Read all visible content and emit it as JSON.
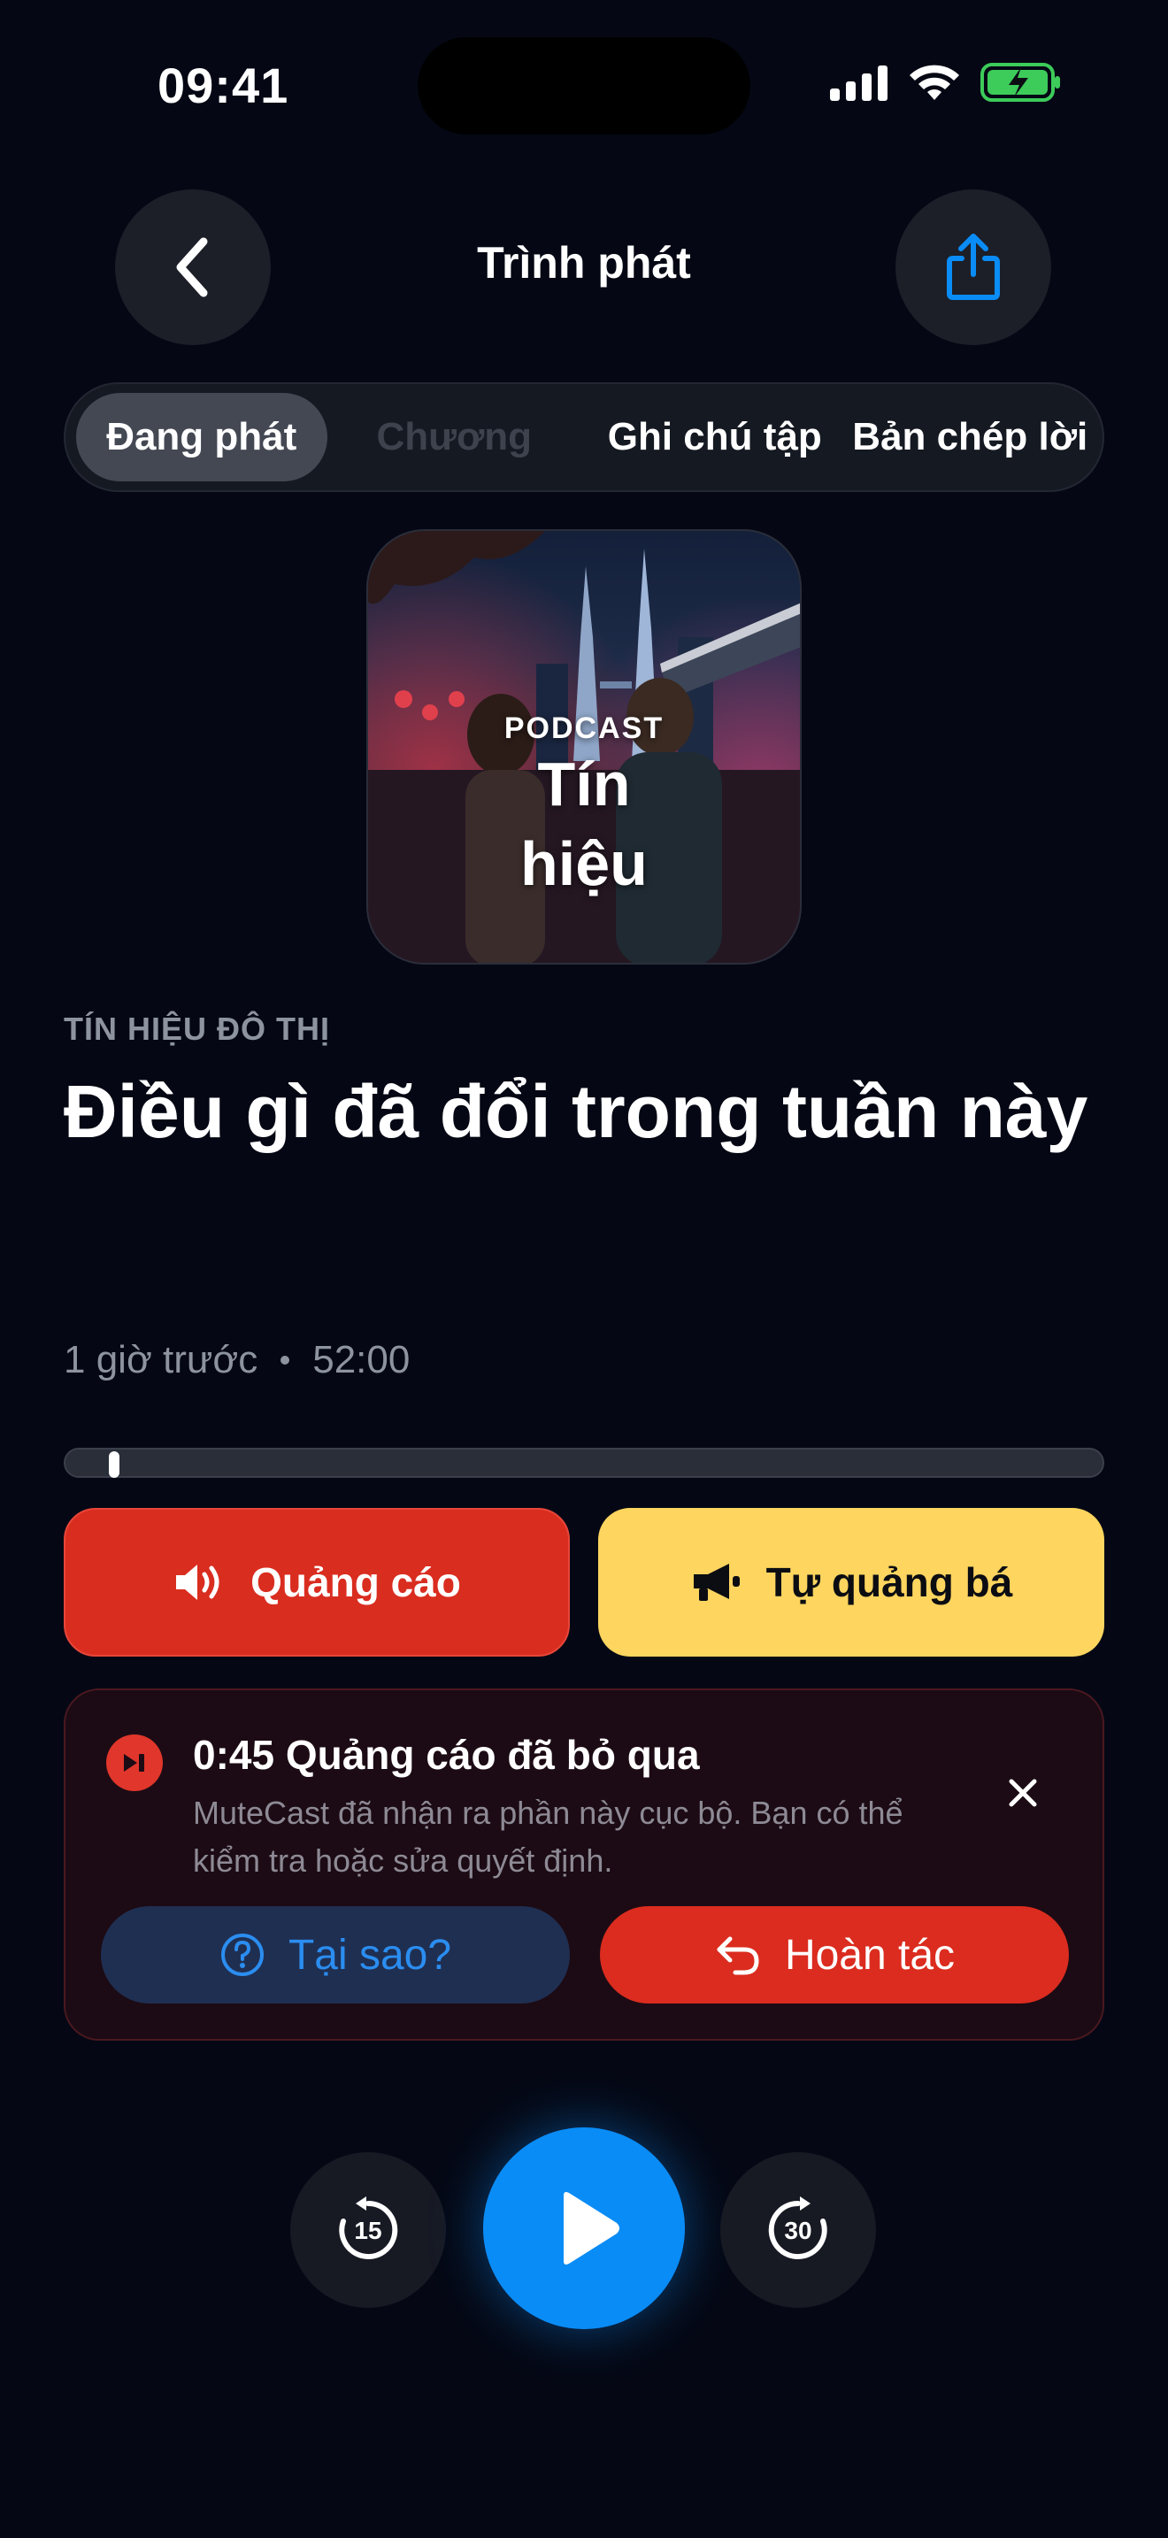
{
  "status_bar": {
    "time": "09:41",
    "icons": [
      "cellular-signal-icon",
      "wifi-icon",
      "battery-charging-icon"
    ]
  },
  "header": {
    "title": "Trình phát",
    "back_icon": "chevron-left-icon",
    "share_icon": "share-icon"
  },
  "tabs": [
    {
      "label": "Đang phát",
      "state": "active"
    },
    {
      "label": "Chương",
      "state": "disabled"
    },
    {
      "label": "Ghi chú tập",
      "state": "normal"
    },
    {
      "label": "Bản chép lời",
      "state": "normal"
    }
  ],
  "artwork": {
    "kicker": "PODCAST",
    "title_line1": "Tín",
    "title_line2": "hiệu"
  },
  "episode": {
    "show_name": "TÍN HIỆU ĐÔ THỊ",
    "title": "Điều gì đã đổi trong tuần này",
    "published": "1 giờ trước",
    "duration": "52:00"
  },
  "progress": {
    "fraction": 0.047
  },
  "segments": {
    "ads_label": "Quảng cáo",
    "promo_label": "Tự quảng bá",
    "ads_color": "#d92d20",
    "promo_color": "#fdd55f"
  },
  "skipped_card": {
    "title": "0:45 Quảng cáo đã bỏ qua",
    "description": "MuteCast đã nhận ra phần này cục bộ. Bạn có thể kiểm tra hoặc sửa quyết định.",
    "why_label": "Tại sao?",
    "undo_label": "Hoàn tác"
  },
  "controls": {
    "skip_back_seconds": "15",
    "skip_forward_seconds": "30",
    "accent": "#0a8cf7"
  }
}
